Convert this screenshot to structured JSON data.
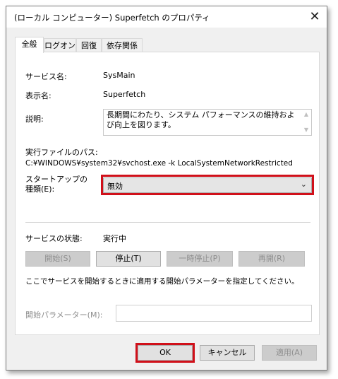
{
  "window": {
    "title": "(ローカル コンピューター) Superfetch のプロパティ",
    "close_glyph": "✕"
  },
  "tabs": [
    "全般",
    "ログオン",
    "回復",
    "依存関係"
  ],
  "general": {
    "service_name_label": "サービス名:",
    "service_name_value": "SysMain",
    "display_name_label": "表示名:",
    "display_name_value": "Superfetch",
    "description_label": "説明:",
    "description_value": "長期間にわたり、システム パフォーマンスの維持および向上を図ります。",
    "exe_path_label": "実行ファイルのパス:",
    "exe_path_value": "C:¥WINDOWS¥system32¥svchost.exe -k LocalSystemNetworkRestricted",
    "startup_type_label": "スタートアップの\n種類(E):",
    "startup_type_value": "無効",
    "service_status_label": "サービスの状態:",
    "service_status_value": "実行中",
    "buttons": {
      "start": "開始(S)",
      "stop": "停止(T)",
      "pause": "一時停止(P)",
      "resume": "再開(R)"
    },
    "hint_text": "ここでサービスを開始するときに適用する開始パラメーターを指定してください。",
    "start_params_label": "開始パラメーター(M):",
    "start_params_value": ""
  },
  "footer": {
    "ok": "OK",
    "cancel": "キャンセル",
    "apply": "適用(A)"
  },
  "icons": {
    "dropdown": "chevron-down-icon",
    "scroll_up": "scroll-up-arrow-icon",
    "scroll_down": "scroll-down-arrow-icon"
  },
  "colors": {
    "highlight": "#d0101a",
    "window_bg": "#f0f0f0",
    "panel_bg": "#ffffff"
  }
}
